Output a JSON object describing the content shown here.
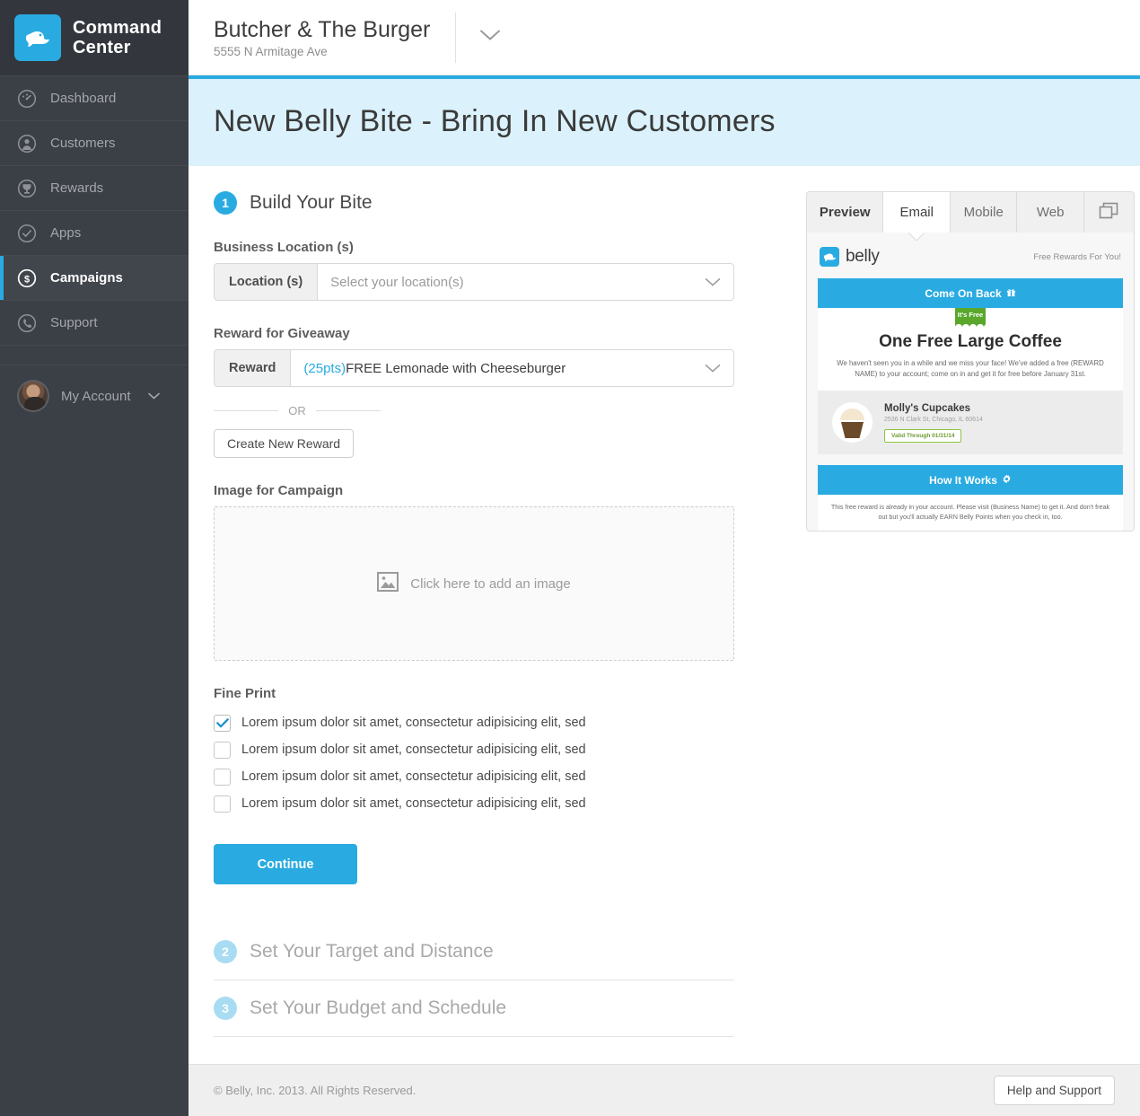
{
  "sidebar": {
    "brand": {
      "title": "Command Center",
      "logo_icon": "belly-bird-logo"
    },
    "items": [
      {
        "label": "Dashboard",
        "icon": "gauge-icon",
        "active": false
      },
      {
        "label": "Customers",
        "icon": "person-icon",
        "active": false
      },
      {
        "label": "Rewards",
        "icon": "trophy-icon",
        "active": false
      },
      {
        "label": "Apps",
        "icon": "check-circle-icon",
        "active": false
      },
      {
        "label": "Campaigns",
        "icon": "dollar-circle-icon",
        "active": true
      },
      {
        "label": "Support",
        "icon": "phone-icon",
        "active": false
      }
    ],
    "account": {
      "label": "My Account",
      "caret_icon": "chevron-down-icon",
      "avatar_icon": "user-avatar"
    }
  },
  "topbar": {
    "store_name": "Butcher & The Burger",
    "store_address": "5555 N Armitage Ave",
    "caret_icon": "chevron-down-icon"
  },
  "banner": {
    "title": "New Belly Bite - Bring In New Customers"
  },
  "steps": [
    {
      "number": "1",
      "title": "Build Your Bite"
    },
    {
      "number": "2",
      "title": "Set Your Target and Distance"
    },
    {
      "number": "3",
      "title": "Set Your Budget and Schedule"
    }
  ],
  "form": {
    "location_label": "Business Location (s)",
    "location_prefix": "Location (s)",
    "location_placeholder": "Select your location(s)",
    "reward_label": "Reward for Giveaway",
    "reward_prefix": "Reward",
    "reward_points": "(25pts)",
    "reward_value": " FREE Lemonade with Cheeseburger",
    "or_text": "OR",
    "create_reward_button": "Create New Reward",
    "image_label": "Image for Campaign",
    "dropzone_text": "Click here to add an image",
    "dropzone_icon": "image-placeholder-icon",
    "fine_print_label": "Fine Print",
    "fine_print_items": [
      {
        "text": "Lorem ipsum dolor sit amet, consectetur adipisicing elit, sed",
        "checked": true
      },
      {
        "text": "Lorem ipsum dolor sit amet, consectetur adipisicing elit, sed",
        "checked": false
      },
      {
        "text": "Lorem ipsum dolor sit amet, consectetur adipisicing elit, sed",
        "checked": false
      },
      {
        "text": "Lorem ipsum dolor sit amet, consectetur adipisicing elit, sed",
        "checked": false
      }
    ],
    "continue_button": "Continue"
  },
  "preview": {
    "tabs": [
      {
        "label": "Preview",
        "active": false,
        "is_label": true
      },
      {
        "label": "Email",
        "active": true,
        "is_label": false
      },
      {
        "label": "Mobile",
        "active": false,
        "is_label": false
      },
      {
        "label": "Web",
        "active": false,
        "is_label": false
      }
    ],
    "expand_icon": "windows-copy-icon",
    "email": {
      "logo_word": "belly",
      "logo_icon": "belly-bird-logo",
      "tagline": "Free Rewards For You!",
      "bar_top": "Come On Back",
      "bar_top_icon": "gift-icon",
      "ribbon": "It's Free",
      "reward_title": "One Free Large Coffee",
      "reward_description": "We haven't seen you in a while and we miss your face! We've added a free (REWARD NAME) to your account; come on in and get it for free before January 31st.",
      "business_name": "Molly's Cupcakes",
      "business_address": "2536 N Clark St, Chicago, IL 60614",
      "business_logo_icon": "cupcake-icon",
      "valid_badge": "Valid Through 01/31/14",
      "bar_bottom": "How It Works",
      "bar_bottom_icon": "gear-icon",
      "footer_text": "This free reward is already in your account. Please visit (Business Name) to get it. And don't freak out but you'll actually EARN Belly Points when you check in, too."
    }
  },
  "footer": {
    "copyright": "© Belly, Inc. 2013. All Rights Reserved.",
    "help_button": "Help and Support"
  },
  "colors": {
    "accent": "#29abe2",
    "banner_bg": "#dbf1fb",
    "sidebar_bg": "#3b3f46",
    "green": "#5aa72c"
  }
}
